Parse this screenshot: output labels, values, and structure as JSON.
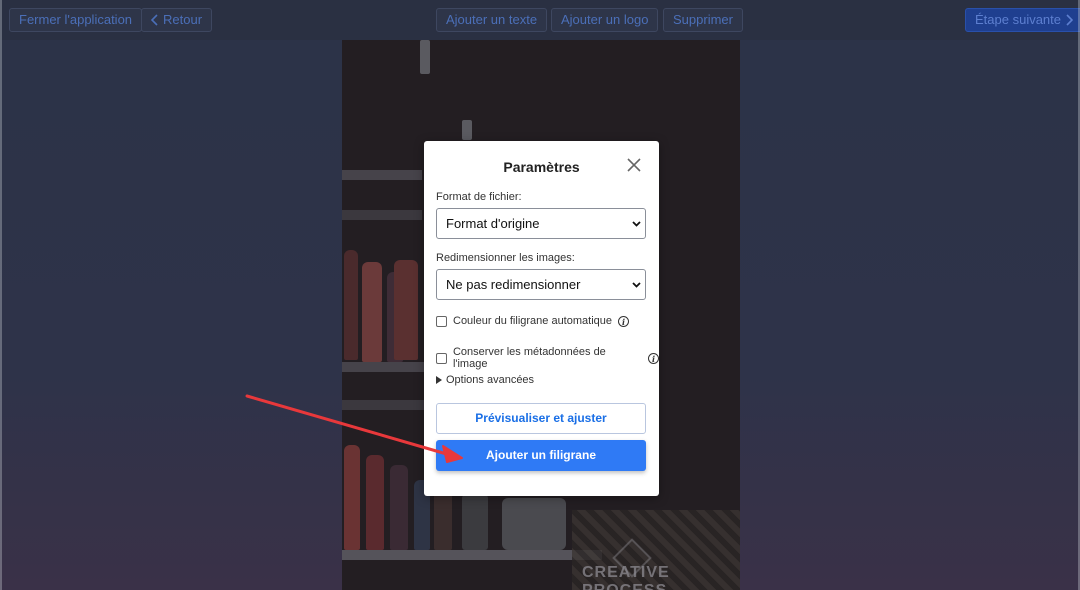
{
  "toolbar": {
    "close_app": "Fermer l'application",
    "back": "Retour",
    "add_text": "Ajouter un texte",
    "add_logo": "Ajouter un logo",
    "delete": "Supprimer",
    "next_step": "Étape suivante"
  },
  "photo": {
    "watermark_text": "CREATIVE PROCESS"
  },
  "modal": {
    "title": "Paramètres",
    "file_format_label": "Format de fichier:",
    "file_format_value": "Format d'origine",
    "resize_label": "Redimensionner les images:",
    "resize_value": "Ne pas redimensionner",
    "auto_color_label": "Couleur du filigrane automatique",
    "auto_color_checked": false,
    "keep_metadata_label": "Conserver les métadonnées de l'image",
    "keep_metadata_checked": false,
    "advanced_options": "Options avancées",
    "preview_button": "Prévisualiser et ajuster",
    "add_watermark_button": "Ajouter un filigrane"
  },
  "colors": {
    "accent": "#2f7af5",
    "annotation_arrow": "#e8383b"
  },
  "icons": [
    "chevron-left-icon",
    "chevron-right-icon",
    "close-icon",
    "chevron-down-icon",
    "info-icon",
    "triangle-right-icon"
  ]
}
